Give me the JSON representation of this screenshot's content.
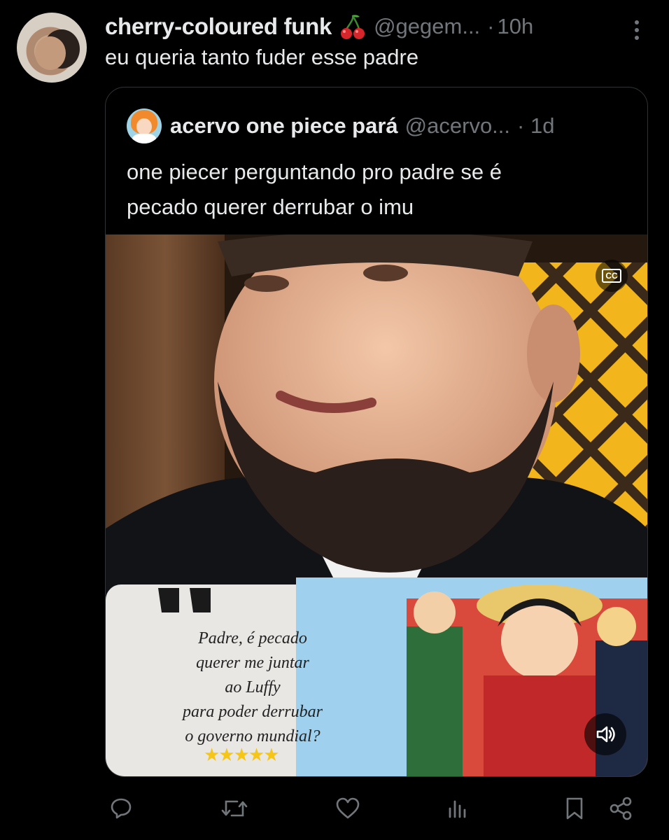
{
  "tweet": {
    "author_name": "cherry-coloured funk",
    "author_emoji": "cherries-icon",
    "handle": "@gegem...",
    "separator": "·",
    "time": "10h",
    "text": "eu queria tanto fuder esse padre"
  },
  "quoted": {
    "author_name": "acervo one piece pará",
    "handle": "@acervo...",
    "separator": "·",
    "time": "1d",
    "text_line1": "one piecer perguntando pro padre se é",
    "text_line2": "pecado querer derrubar o imu",
    "video": {
      "cc_label": "CC",
      "card_text": [
        "Padre, é pecado",
        "querer me juntar",
        "ao Luffy",
        "para poder derrubar",
        "o governo mundial?"
      ],
      "rating_stars": 5
    }
  },
  "actions": [
    "reply-icon",
    "retweet-icon",
    "like-icon",
    "views-icon",
    "bookmark-icon",
    "share-icon"
  ],
  "colors": {
    "background": "#000000",
    "text": "#e7e9ea",
    "secondary": "#71767b",
    "border": "#2f3336"
  }
}
